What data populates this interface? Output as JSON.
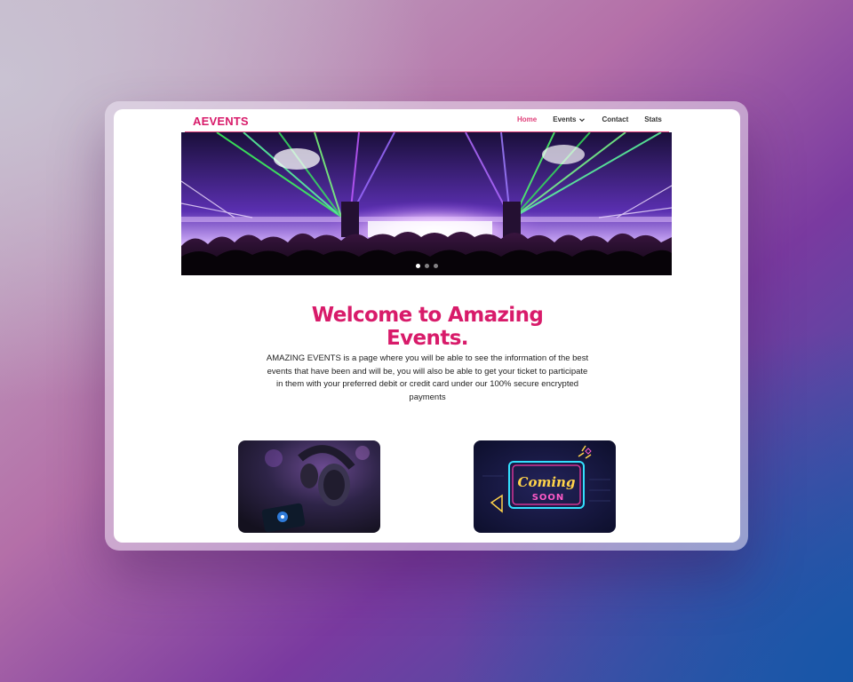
{
  "brand": {
    "logo_text": "AEVENTS"
  },
  "nav": {
    "items": [
      {
        "label": "Home",
        "active": true
      },
      {
        "label": "Events",
        "has_dropdown": true
      },
      {
        "label": "Contact"
      },
      {
        "label": "Stats"
      }
    ]
  },
  "hero": {
    "slides": 3,
    "current_slide": 1
  },
  "main": {
    "title": "Welcome to Amazing Events.",
    "description": "AMAZING EVENTS is a page where you will be able to see the information of the best events that have been and will be, you will also be able to get your ticket to participate in them with your preferred debit or credit card under our 100% secure encrypted payments"
  },
  "cards": [
    {
      "icon": "headphones-image"
    },
    {
      "sign_line1": "Coming",
      "sign_line2": "SOON"
    }
  ],
  "colors": {
    "accent": "#d81b6a",
    "nav_active": "#e0407a"
  }
}
